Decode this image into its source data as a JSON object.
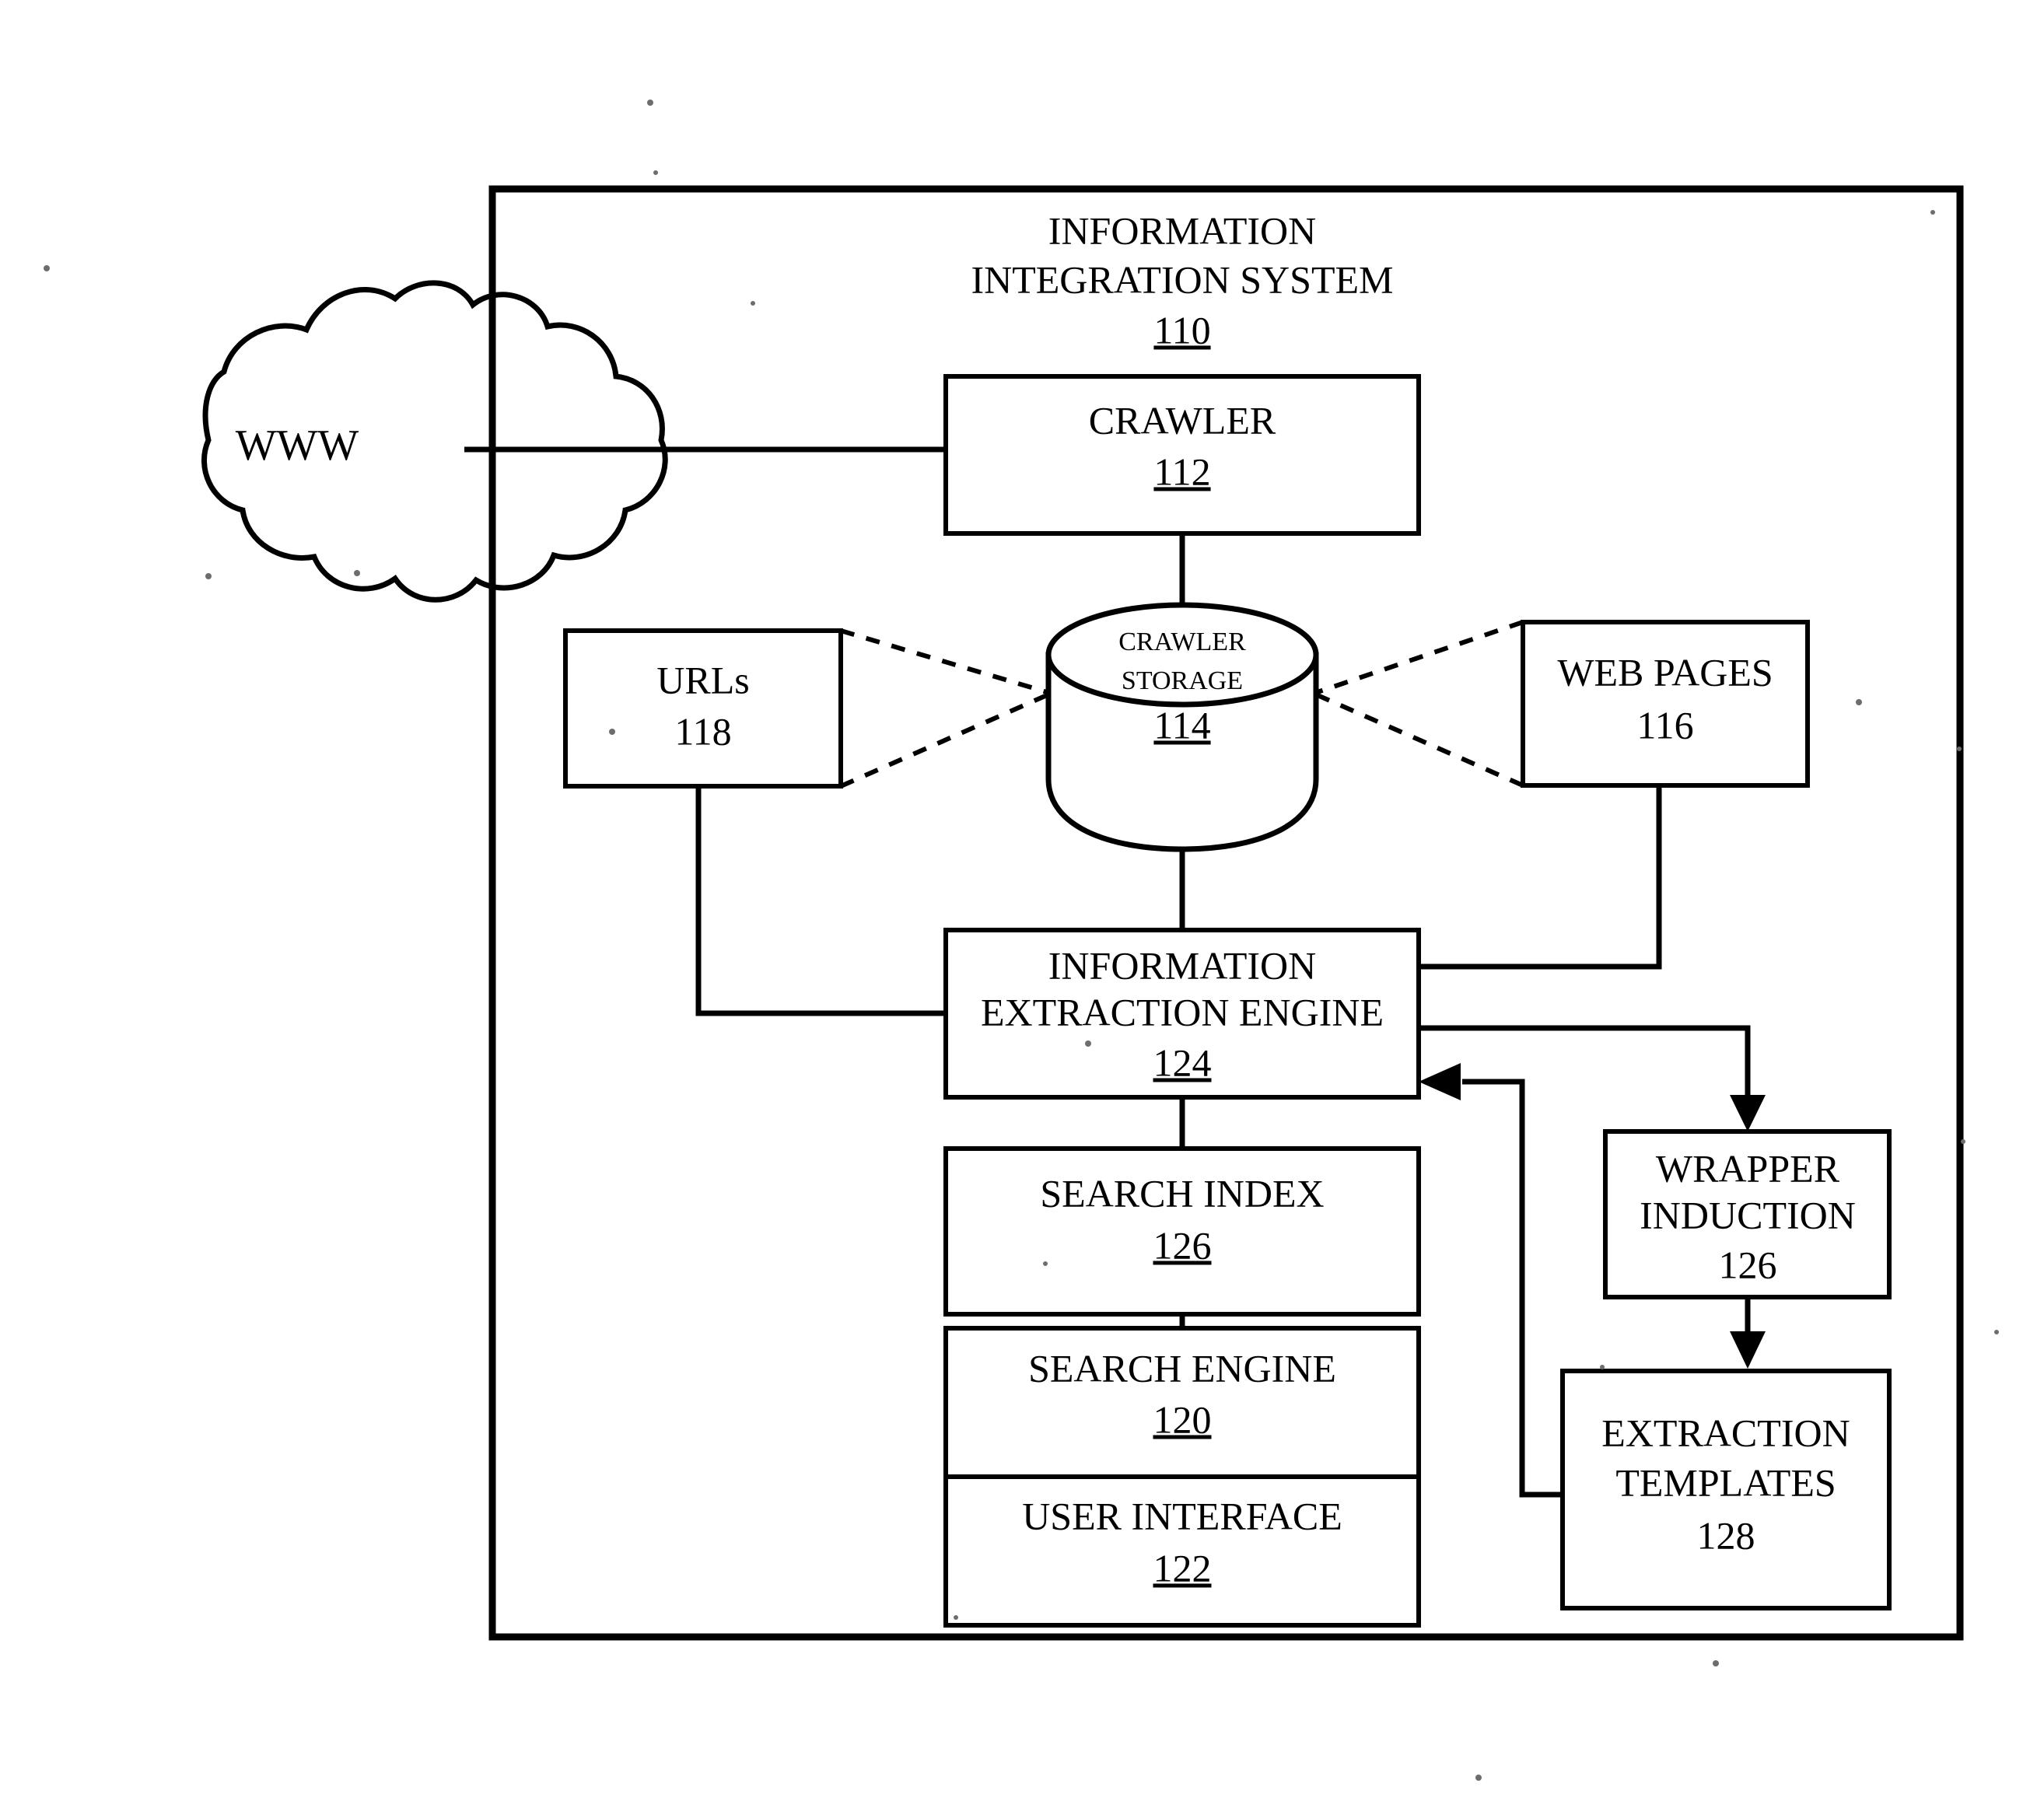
{
  "figure": {
    "system_title_line1": "INFORMATION",
    "system_title_line2": "INTEGRATION SYSTEM",
    "system_number": "110"
  },
  "nodes": {
    "www": {
      "label": "WWW"
    },
    "crawler": {
      "label": "CRAWLER",
      "number": "112"
    },
    "crawler_storage": {
      "label_line1": "CRAWLER",
      "label_line2": "STORAGE",
      "number": "114"
    },
    "urls": {
      "label": "URLs",
      "number": "118"
    },
    "web_pages": {
      "label": "WEB PAGES",
      "number": "116"
    },
    "information_extraction_engine": {
      "label_line1": "INFORMATION",
      "label_line2": "EXTRACTION ENGINE",
      "number": "124"
    },
    "search_index": {
      "label": "SEARCH INDEX",
      "number": "126"
    },
    "search_engine": {
      "label": "SEARCH ENGINE",
      "number": "120"
    },
    "user_interface": {
      "label": "USER INTERFACE",
      "number": "122"
    },
    "wrapper_induction": {
      "label_line1": "WRAPPER",
      "label_line2": "INDUCTION",
      "number": "126"
    },
    "extraction_templates": {
      "label_line1": "EXTRACTION",
      "label_line2": "TEMPLATES",
      "number": "128"
    }
  },
  "colors": {
    "stroke": "#000000",
    "background": "#ffffff"
  }
}
